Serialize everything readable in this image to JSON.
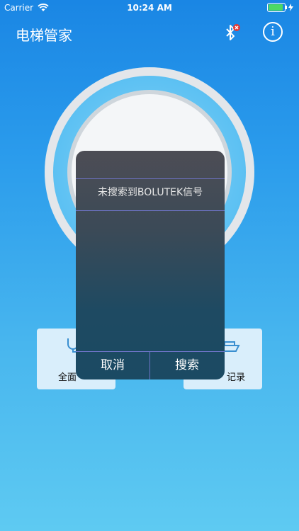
{
  "status_bar": {
    "carrier": "Carrier",
    "time": "10:24 AM"
  },
  "header": {
    "title": "电梯管家",
    "info_symbol": "i"
  },
  "cards": {
    "left_label": "全面",
    "right_label": "记录"
  },
  "dialog": {
    "message": "未搜索到BOLUTEK信号",
    "cancel_label": "取消",
    "search_label": "搜索"
  },
  "colors": {
    "accent": "#1a86e4",
    "battery": "#4cd964",
    "bt_badge": "#e53935"
  }
}
